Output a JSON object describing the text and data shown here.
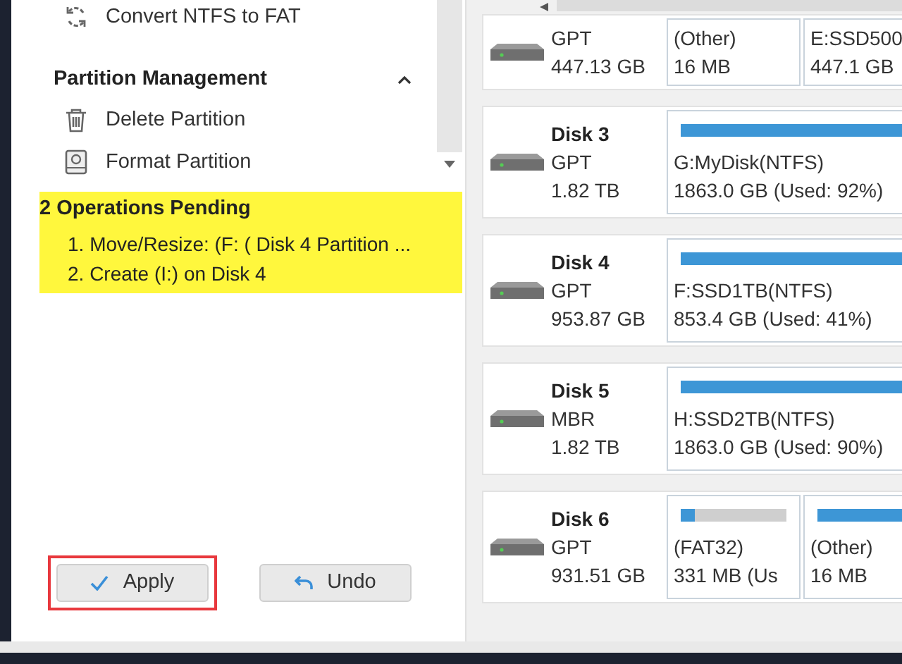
{
  "sidebar": {
    "items": [
      {
        "label": "Convert NTFS to FAT"
      }
    ],
    "section": {
      "title": "Partition Management",
      "expanded": true,
      "items": [
        {
          "label": "Delete Partition"
        },
        {
          "label": "Format Partition"
        }
      ]
    }
  },
  "pending": {
    "title": "2 Operations Pending",
    "operations": [
      "1. Move/Resize: (F: ( Disk 4 Partition ...",
      "2. Create (I:) on Disk 4"
    ]
  },
  "buttons": [
    {
      "label": "Apply",
      "highlighted": true
    },
    {
      "label": "Undo",
      "highlighted": false
    }
  ],
  "disks": [
    {
      "type": "GPT",
      "size": "447.13 GB",
      "partitions": [
        {
          "label": "(Other)",
          "size": "16 MB"
        },
        {
          "label": "E:SSD500",
          "size": "447.1 GB"
        }
      ]
    },
    {
      "name": "Disk 3",
      "type": "GPT",
      "size": "1.82 TB",
      "partitions": [
        {
          "label": "G:MyDisk(NTFS)",
          "size": "1863.0 GB (Used: 92%)",
          "level": 1
        }
      ]
    },
    {
      "name": "Disk 4",
      "type": "GPT",
      "size": "953.87 GB",
      "partitions": [
        {
          "label": "F:SSD1TB(NTFS)",
          "size": "853.4 GB (Used: 41%)",
          "level": 1
        }
      ]
    },
    {
      "name": "Disk 5",
      "type": "MBR",
      "size": "1.82 TB",
      "partitions": [
        {
          "label": "H:SSD2TB(NTFS)",
          "size": "1863.0 GB (Used: 90%)",
          "level": 1
        }
      ]
    },
    {
      "name": "Disk 6",
      "type": "GPT",
      "size": "931.51 GB",
      "partitions": [
        {
          "label": "(FAT32)",
          "size": "331 MB (Us",
          "level": 0.13
        },
        {
          "label": "(Other)",
          "size": "16 MB",
          "level": 1
        }
      ]
    }
  ]
}
